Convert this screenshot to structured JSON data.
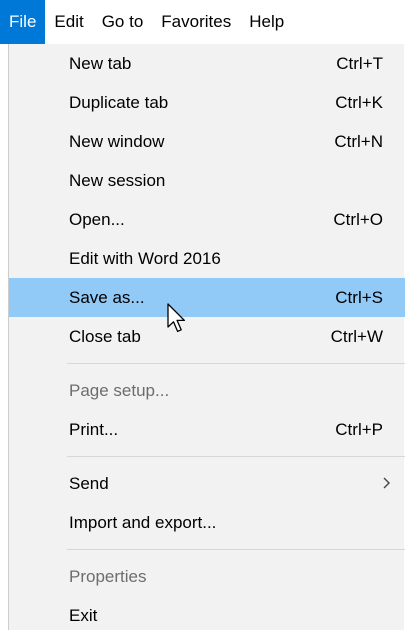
{
  "menubar": {
    "items": [
      {
        "label": "File"
      },
      {
        "label": "Edit"
      },
      {
        "label": "Go to"
      },
      {
        "label": "Favorites"
      },
      {
        "label": "Help"
      }
    ]
  },
  "file_menu": {
    "new_tab": {
      "label": "New tab",
      "shortcut": "Ctrl+T"
    },
    "duplicate_tab": {
      "label": "Duplicate tab",
      "shortcut": "Ctrl+K"
    },
    "new_window": {
      "label": "New window",
      "shortcut": "Ctrl+N"
    },
    "new_session": {
      "label": "New session"
    },
    "open": {
      "label": "Open...",
      "shortcut": "Ctrl+O"
    },
    "edit_with_word": {
      "label": "Edit with Word 2016"
    },
    "save_as": {
      "label": "Save as...",
      "shortcut": "Ctrl+S"
    },
    "close_tab": {
      "label": "Close tab",
      "shortcut": "Ctrl+W"
    },
    "page_setup": {
      "label": "Page setup..."
    },
    "print": {
      "label": "Print...",
      "shortcut": "Ctrl+P"
    },
    "send": {
      "label": "Send"
    },
    "import_export": {
      "label": "Import and export..."
    },
    "properties": {
      "label": "Properties"
    },
    "exit": {
      "label": "Exit"
    }
  },
  "colors": {
    "active_menu": "#0078d7",
    "highlight_row": "#91c9f7",
    "menu_background": "#f2f2f2",
    "disabled_text": "#6d6d6d"
  },
  "icons": {
    "submenu": "chevron-right-icon",
    "pointer": "mouse-cursor-icon"
  }
}
